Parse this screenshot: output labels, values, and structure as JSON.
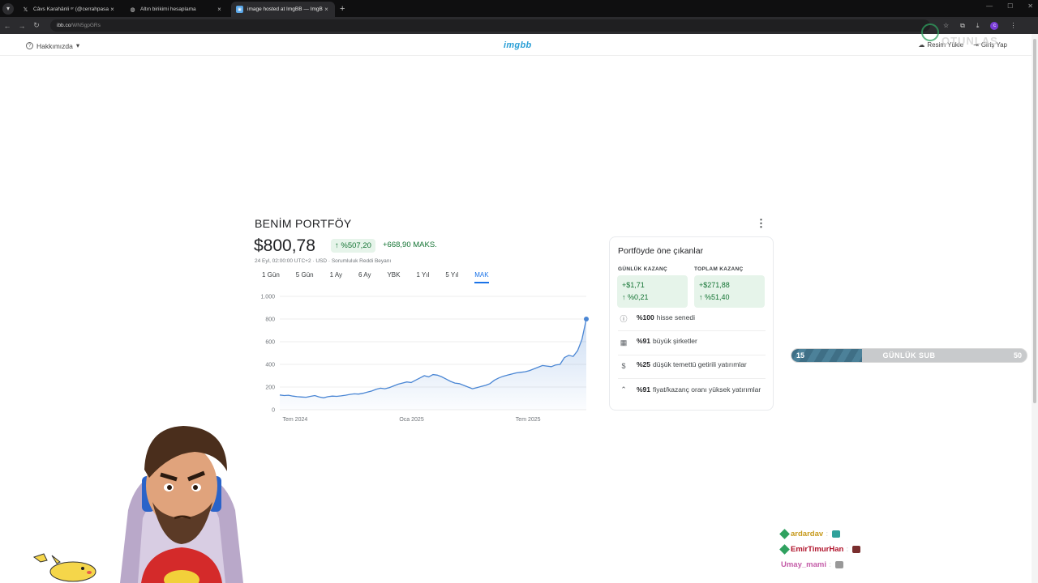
{
  "browser": {
    "tabs": [
      {
        "title": "Câvs Karahânli ᵒʳ (@cerrahpasa",
        "icon": "x-logo-icon",
        "active": false
      },
      {
        "title": "Altın birikimi hesaplama",
        "icon": "globe-icon",
        "active": false
      },
      {
        "title": "image hosted at ImgBB — ImgBB",
        "icon": "imgbb-icon",
        "active": true
      }
    ],
    "url_domain": "ibb.co",
    "url_path": "/WN5gpGRs",
    "profile_initial": "c"
  },
  "site": {
    "about_label": "Hakkımızda",
    "logo": "imgbb",
    "upload_label": "Resim Yükle",
    "login_label": "Giriş Yap"
  },
  "overlay_logo_text": "OTUNLAS",
  "portfolio": {
    "title": "BENİM PORTFÖY",
    "value": "$800,78",
    "change_pct": "↑ %507,20",
    "change_abs": "+668,90 MAKS.",
    "meta": "24 Eyl, 02:00:00 UTC+2 · USD · Sorumluluk Reddi Beyanı",
    "ranges": [
      "1 Gün",
      "5 Gün",
      "1 Ay",
      "6 Ay",
      "YBK",
      "1 Yıl",
      "5 Yıl",
      "MAK"
    ],
    "active_range": "MAK"
  },
  "highlights": {
    "title": "Portföyde öne çıkanlar",
    "daily_label": "GÜNLÜK KAZANÇ",
    "daily_abs": "+$1,71",
    "daily_pct": "↑ %0,21",
    "total_label": "TOPLAM KAZANÇ",
    "total_abs": "+$271,88",
    "total_pct": "↑ %51,40",
    "rows": [
      {
        "bold": "%100",
        "text": "hisse senedi",
        "icon": "info-icon"
      },
      {
        "bold": "%91",
        "text": "büyük şirketler",
        "icon": "building-icon"
      },
      {
        "bold": "%25",
        "text": "düşük temettü getirili yatırımlar",
        "icon": "dollar-icon"
      },
      {
        "bold": "%91",
        "text": "fiyat/kazanç oranı yüksek yatırımlar",
        "icon": "chevrons-up-icon"
      }
    ]
  },
  "chart_data": {
    "type": "area",
    "x_ticks": [
      "Tem 2024",
      "Oca 2025",
      "Tem 2025"
    ],
    "y_ticks": [
      "0",
      "200",
      "400",
      "600",
      "800",
      "1.000"
    ],
    "ylim": [
      0,
      1000
    ],
    "grid": true,
    "color": "#4a86d4",
    "values": [
      130,
      125,
      128,
      120,
      115,
      112,
      110,
      118,
      125,
      112,
      105,
      115,
      120,
      118,
      122,
      128,
      135,
      140,
      138,
      145,
      155,
      165,
      180,
      190,
      185,
      195,
      210,
      225,
      235,
      245,
      240,
      260,
      280,
      300,
      290,
      310,
      305,
      290,
      270,
      250,
      235,
      230,
      215,
      200,
      185,
      195,
      205,
      215,
      230,
      260,
      280,
      295,
      305,
      315,
      325,
      330,
      335,
      345,
      360,
      375,
      390,
      385,
      380,
      395,
      400,
      460,
      480,
      470,
      520,
      620,
      800
    ]
  },
  "sub_goal": {
    "current": "15",
    "label": "GÜNLÜK SUB",
    "goal": "50",
    "progress": 0.3
  },
  "chat": [
    {
      "user": "ardardav",
      "color": "#c79a1c",
      "message": ":"
    },
    {
      "user": "EmirTimurHan",
      "color": "#b0122a",
      "message": ":"
    },
    {
      "user": "Umay_mami",
      "color": "#c45ca8",
      "message": ":"
    }
  ]
}
